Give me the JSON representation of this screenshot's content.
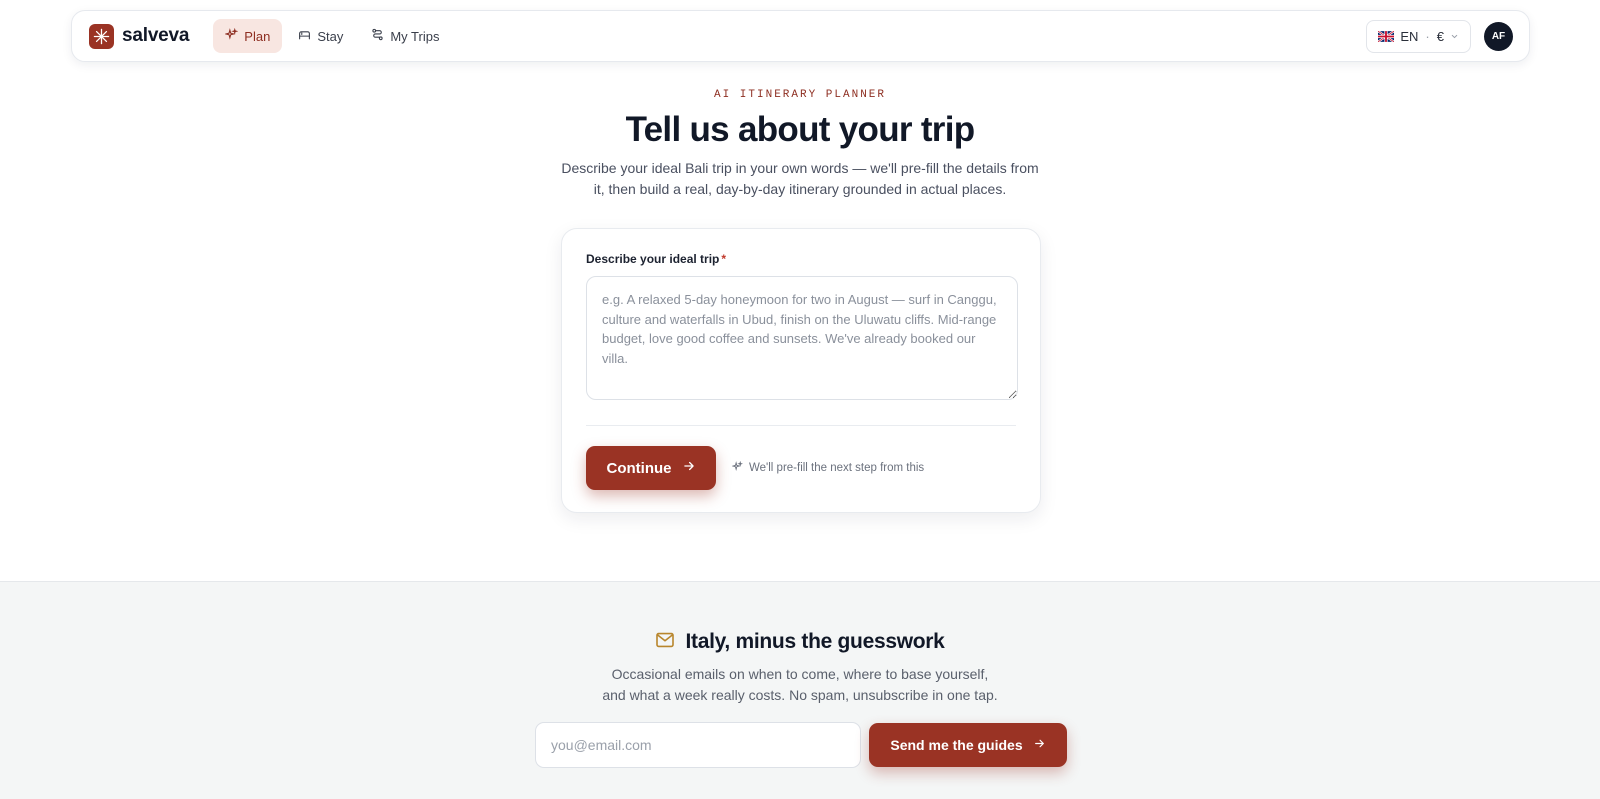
{
  "colors": {
    "brand": "#9a3324",
    "brand_soft": "#f8e6e1",
    "text_dark": "#111827",
    "newsletter_bg": "#f4f6f6"
  },
  "navbar": {
    "brand_name": "salveva",
    "brand_icon": "sparkle-logo-icon",
    "links": [
      {
        "label": "Plan",
        "icon": "sparkles-icon",
        "active": true
      },
      {
        "label": "Stay",
        "icon": "bed-icon",
        "active": false
      },
      {
        "label": "My Trips",
        "icon": "route-icon",
        "active": false
      }
    ],
    "locale": {
      "language": "EN",
      "currency": "€",
      "flag": "uk-flag-icon"
    },
    "avatar_initials": "AF"
  },
  "hero": {
    "eyebrow": "AI ITINERARY PLANNER",
    "title": "Tell us about your trip",
    "subtitle": "Describe your ideal Bali trip in your own words — we'll pre-fill the details from it, then build a real, day-by-day itinerary grounded in actual places."
  },
  "form": {
    "label": "Describe your ideal trip",
    "required_mark": "*",
    "value": "",
    "placeholder": "e.g. A relaxed 5-day honeymoon for two in August — surf in Canggu, culture and waterfalls in Ubud, finish on the Uluwatu cliffs. Mid-range budget, love good coffee and sunsets. We've already booked our villa.",
    "continue_label": "Continue",
    "hint": "We'll pre-fill the next step from this"
  },
  "newsletter": {
    "title": "Italy, minus the guesswork",
    "subtitle": "Occasional emails on when to come, where to base yourself, and what a week really costs. No spam, unsubscribe in one tap.",
    "email_value": "",
    "email_placeholder": "you@email.com",
    "submit_label": "Send me the guides"
  }
}
